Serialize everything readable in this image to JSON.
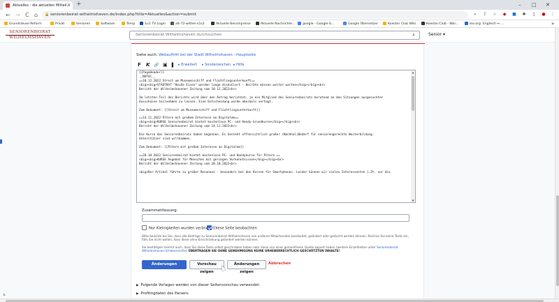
{
  "browser": {
    "tab_title": "Aktuelles - die aktuellen Mitteil...",
    "new_tab": "+",
    "url": "seniorenbeirat-wilhelmshaven.de/index.php?title=Aktuelles&action=submit",
    "window_controls": [
      "–",
      "□",
      "✕"
    ],
    "nav": {
      "back": "←",
      "forward": "→",
      "reload": "C",
      "home": "⌂"
    },
    "bookmarks": [
      {
        "label": "Grundsteuer-Reform",
        "color": "#f4b400"
      },
      {
        "label": "Privat",
        "color": "#f4b400"
      },
      {
        "label": "Senioren",
        "color": "#f4b400"
      },
      {
        "label": "Software",
        "color": "#f4b400"
      },
      {
        "label": "Temp",
        "color": "#f4b400"
      },
      {
        "label": "1u1 TV Login",
        "color": "#1c4e9d"
      },
      {
        "label": "alt-72-witten-s1s2",
        "color": "#555555"
      },
      {
        "label": "Aktuelle Benzinpreise",
        "color": "#333333"
      },
      {
        "label": "Aktuelle Nachrichte...",
        "color": "#333333"
      },
      {
        "label": "google - Google-S...",
        "color": "#4285f4"
      },
      {
        "label": "Google Übersetzer",
        "color": "#4285f4"
      },
      {
        "label": "Koester Club Wiki",
        "color": "#f4b400"
      },
      {
        "label": "Koester.Club - Wor...",
        "color": "#333333"
      },
      {
        "label": "leo.org: Englisch ↔ ...",
        "color": "#2a6db5"
      }
    ],
    "bookmarks_more": "»"
  },
  "site": {
    "logo_line1": "SENIORENBEIRAT",
    "logo_line2": "WILHELMSHAVEN",
    "search_placeholder": "Seniorenbeirat Wilhelmshaven durchsuchen",
    "user_menu": "Senior ▾"
  },
  "editor": {
    "see_also_prefix": "Siehe auch: ",
    "see_also_link1": "Webauftritt bei der Stadt Wilhelmshaven",
    "see_also_sep": " - ",
    "see_also_link2": "Hauptseite",
    "toolbar": {
      "bold": "F",
      "italic": "K",
      "link_icon": "🔗",
      "image_icon": "▣",
      "ref_icon": "❚",
      "advanced": "▸ Erweitert",
      "special_chars": "▸ Sonderzeichen",
      "help": "▸ Hilfe"
    },
    "text": "{{PageHeader}}\n__NOTOC__\n==18.12.2022 Streit um Museumsschiff und Flüchtlingsunterkunft==\n<big><big>STADTRAT \"Heiße Eisen\" werden lange diskutiert - Beiräte müssen weiter warten</big></big><br>\nBericht der Wilhelmshavener Zeitung vom 18.12.2022<br>\n\nIm letzten Teil des Berichts wird über den Antrag berichtet, je ein Mitglied des Seniorenbeirats beratend an den Sitzungen ausgesuchter\nAusschüsse teilnehmen zu lassen. Eine Entscheidung wurde abermals vertagt.\n\nZum Dokument: [[Streit um Museumsschiff und Flüchtlingsunterkunft]]\n\n==14.11.2022 Ältere mit großem Interesse an Digitalem==\n<big><big>KURSE Seniorenbeirat bietet kostenlose PC- und Handy-Grundkurse</big></big><br>\nBericht der Wilhelmshavener Zeitung vom 14.11.2022<br>\n\nDie Kurse des Seniorenbeirats haben begonnen. Es besteht offensichtlich großer (Nachhol)Bedarf für seniorengerechte Weiterbildung.\nUnterstützer sind willkommen.\n\nZum Dokument: [[Ältere mit großem Interesse an Digitalem]]\n\n==28.10.2022 Seniorenbeirat bietet kostenlose PC- und Handykurse für Ältere ==\n<big><big>KURSE Angebot für Menschen mit geringen Vorkenntnissen</big></big><br>\nBericht der Wilhelmshavener Zeitung vom 28.10.2022<br>\n\n<big>Der Artikel führte zu großer Resonanz - besonders bei den Kursen für Smartphones. Leider können wir vielen Interessenten i.Zt. nur die",
    "summary_label": "Zusammenfassung:",
    "summary_value": "",
    "minor_edit_label": "Nur Kleinigkeiten wurden verändert",
    "minor_edit_checked": false,
    "watch_label": "Diese Seite beobachten",
    "watch_checked": true,
    "notice1": "Bitte beachte bei Sie, dass alle Beiträge zu Seniorenbeirat Wilhelmshaven von anderen Mitwirkenden bearbeitet, geändert oder gelöscht werden können. Reichen Sie keine Texte ein, falls Sie nicht wollen, dass diese ohne Einschränkung geändert werden können.",
    "notice2_text": "Sie bestätigen hiermit auch, dass Sie diese Texte selbst geschrieben haben oder diese von einer gemeinfreien Quelle kopiert haben (weitere Einzelheiten unter ",
    "notice2_link": "Seniorenbeirat Wilhelmshaven:Urheberrechte",
    "notice2_bold": "ÜBERTRAGEN SIE OHNE GENEHMIGUNG KEINE URHEBERRECHTLICH GESCHÜTZTEN INHALTE!",
    "save_button": "Änderungen speichern",
    "preview_button": "Vorschau zeigen",
    "diff_button": "Änderungen zeigen",
    "cancel_link": "Abbrechen",
    "templates_fold": "Folgende Vorlagen werden von dieser Seitenvorschau verwendet:",
    "parser_fold": "Profilingdaten des Parsers:"
  }
}
